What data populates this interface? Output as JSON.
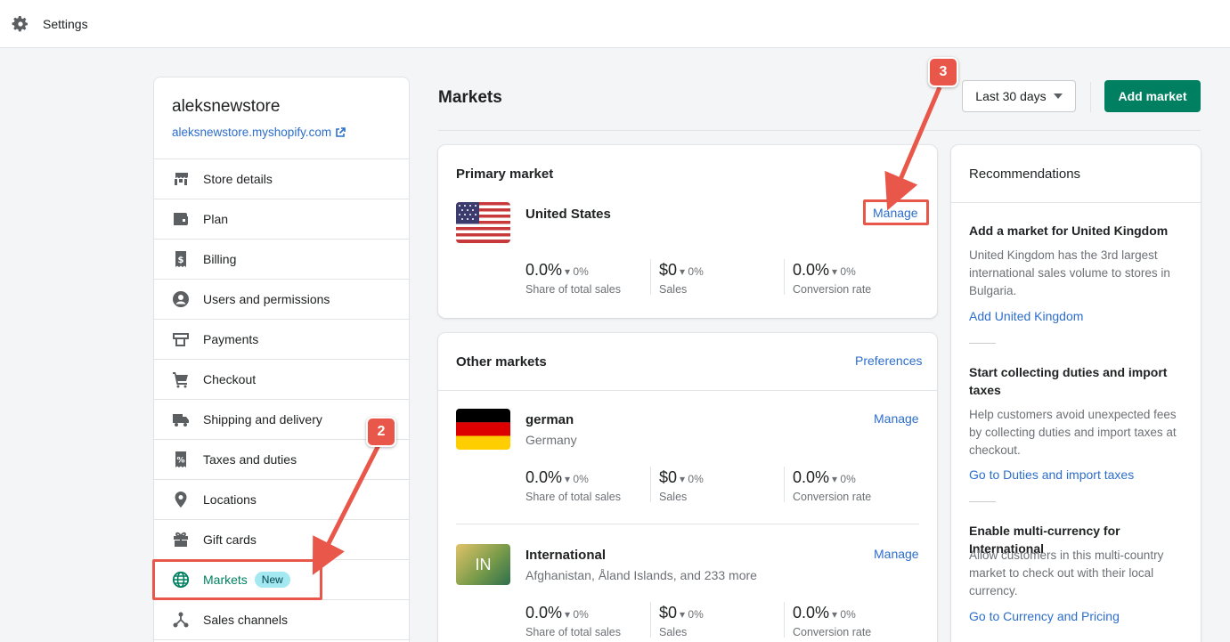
{
  "topbar": {
    "title": "Settings"
  },
  "store": {
    "name": "aleksnewstore",
    "url": "aleksnewstore.myshopify.com"
  },
  "nav": [
    {
      "label": "Store details",
      "icon": "store-icon"
    },
    {
      "label": "Plan",
      "icon": "plan-icon"
    },
    {
      "label": "Billing",
      "icon": "billing-icon"
    },
    {
      "label": "Users and permissions",
      "icon": "user-icon"
    },
    {
      "label": "Payments",
      "icon": "payments-icon"
    },
    {
      "label": "Checkout",
      "icon": "cart-icon"
    },
    {
      "label": "Shipping and delivery",
      "icon": "truck-icon"
    },
    {
      "label": "Taxes and duties",
      "icon": "taxes-icon"
    },
    {
      "label": "Locations",
      "icon": "location-icon"
    },
    {
      "label": "Gift cards",
      "icon": "gift-icon"
    },
    {
      "label": "Markets",
      "icon": "globe-icon",
      "badge": "New"
    },
    {
      "label": "Sales channels",
      "icon": "channels-icon"
    }
  ],
  "header": {
    "title": "Markets",
    "date_range": "Last 30 days",
    "add_market": "Add market"
  },
  "primary": {
    "heading": "Primary market",
    "market": {
      "name": "United States",
      "manage": "Manage",
      "stats": [
        {
          "value": "0.0%",
          "delta": "0%",
          "label": "Share of total sales"
        },
        {
          "value": "$0",
          "delta": "0%",
          "label": "Sales"
        },
        {
          "value": "0.0%",
          "delta": "0%",
          "label": "Conversion rate"
        }
      ]
    }
  },
  "other": {
    "heading": "Other markets",
    "preferences": "Preferences",
    "markets": [
      {
        "name": "german",
        "sub": "Germany",
        "manage": "Manage",
        "stats": [
          {
            "value": "0.0%",
            "delta": "0%",
            "label": "Share of total sales"
          },
          {
            "value": "$0",
            "delta": "0%",
            "label": "Sales"
          },
          {
            "value": "0.0%",
            "delta": "0%",
            "label": "Conversion rate"
          }
        ]
      },
      {
        "name": "International",
        "sub": "Afghanistan, Åland Islands, and 233 more",
        "flag_text": "IN",
        "manage": "Manage",
        "stats": [
          {
            "value": "0.0%",
            "delta": "0%",
            "label": "Share of total sales"
          },
          {
            "value": "$0",
            "delta": "0%",
            "label": "Sales"
          },
          {
            "value": "0.0%",
            "delta": "0%",
            "label": "Conversion rate"
          }
        ]
      }
    ]
  },
  "recommendations": {
    "heading": "Recommendations",
    "items": [
      {
        "title": "Add a market for United Kingdom",
        "text": "United Kingdom has the 3rd largest international sales volume to stores in Bulgaria.",
        "link": "Add United Kingdom"
      },
      {
        "title": "Start collecting duties and import taxes",
        "text": "Help customers avoid unexpected fees by collecting duties and import taxes at checkout.",
        "link": "Go to Duties and import taxes"
      },
      {
        "title": "Enable multi-currency for International",
        "text": "Allow customers in this multi-country market to check out with their local currency.",
        "link": "Go to Currency and Pricing"
      }
    ]
  },
  "annotations": {
    "step2": "2",
    "step3": "3"
  },
  "colors": {
    "accent": "#008060",
    "link": "#2c6ecb",
    "annotation": "#e8574a",
    "badge": "#a4e8f2"
  }
}
